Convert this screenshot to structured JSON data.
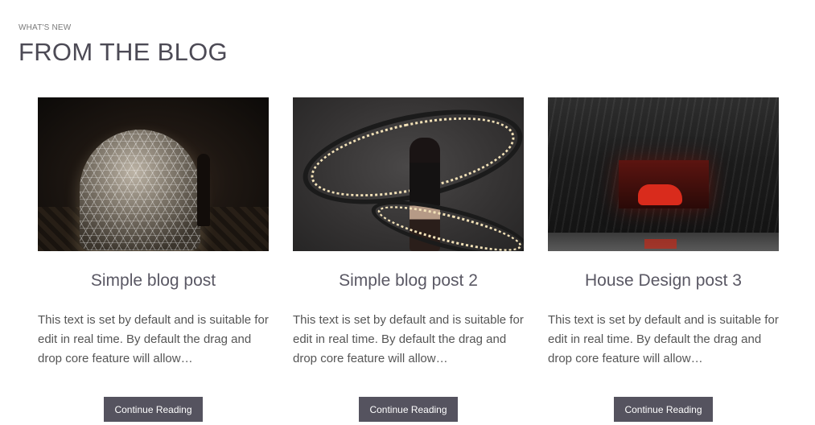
{
  "section": {
    "eyebrow": "WHAT'S NEW",
    "title": "FROM THE BLOG"
  },
  "posts": [
    {
      "title": "Simple blog post",
      "excerpt": "This text is set by default and is suitable for edit in real time. By default the drag and drop core feature will allow…",
      "button_label": "Continue Reading",
      "image": "geodesic-dome-photo"
    },
    {
      "title": "Simple blog post 2",
      "excerpt": "This text is set by default and is suitable for edit in real time. By default the drag and drop core feature will allow…",
      "button_label": "Continue Reading",
      "image": "light-ring-model-photo"
    },
    {
      "title": "House Design post 3",
      "excerpt": "This text is set by default and is suitable for edit in real time. By default the drag and drop core feature will allow…",
      "button_label": "Continue Reading",
      "image": "red-sofa-interior-photo"
    }
  ],
  "colors": {
    "button_bg": "#55535f",
    "title_text": "#4c4a55"
  }
}
